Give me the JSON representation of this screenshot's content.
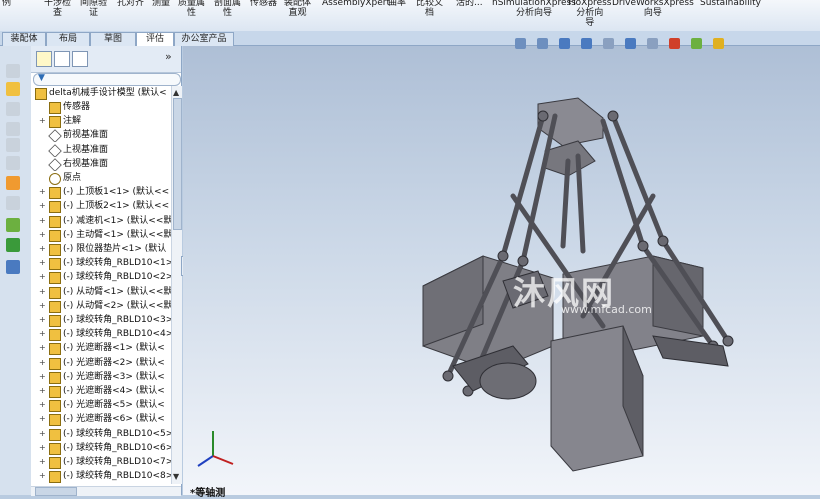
{
  "ribbon": {
    "items": [
      "例",
      "干涉检\n查",
      "间隙验\n证",
      "孔对齐",
      "测量",
      "质量属\n性",
      "剖面属\n性",
      "传感器",
      "装配体\n直观",
      "AssemblyXpert",
      "曲率",
      "比较文\n档",
      "活的...",
      "nSimulationXpress\n分析向导",
      "FloXpress\n分析向\n导",
      "DriveWorksXpress\n向导",
      "Sustainability"
    ]
  },
  "tabs": {
    "items": [
      "装配体",
      "布局",
      "草图",
      "评估",
      "办公室产品"
    ],
    "active": "评估"
  },
  "tree": {
    "root": "delta机械手设计模型 (默认<",
    "items": [
      {
        "label": "传感器",
        "kind": "sensor",
        "exp": ""
      },
      {
        "label": "注解",
        "kind": "note",
        "exp": "+"
      },
      {
        "label": "前视基准面",
        "kind": "plane",
        "exp": ""
      },
      {
        "label": "上视基准面",
        "kind": "plane",
        "exp": ""
      },
      {
        "label": "右视基准面",
        "kind": "plane",
        "exp": ""
      },
      {
        "label": "原点",
        "kind": "origin",
        "exp": ""
      },
      {
        "label": "(-) 上顶板1<1> (默认<<",
        "kind": "part",
        "exp": "+"
      },
      {
        "label": "(-) 上顶板2<1> (默认<<",
        "kind": "part",
        "exp": "+"
      },
      {
        "label": "(-) 减速机<1> (默认<<默",
        "kind": "part",
        "exp": "+"
      },
      {
        "label": "(-) 主动臂<1> (默认<<默",
        "kind": "part",
        "exp": "+"
      },
      {
        "label": "(-) 限位器垫片<1> (默认",
        "kind": "part",
        "exp": "+"
      },
      {
        "label": "(-) 球绞转角_RBLD10<1>",
        "kind": "part",
        "exp": "+"
      },
      {
        "label": "(-) 球绞转角_RBLD10<2>",
        "kind": "part",
        "exp": "+"
      },
      {
        "label": "(-) 从动臂<1> (默认<<默",
        "kind": "part",
        "exp": "+"
      },
      {
        "label": "(-) 从动臂<2> (默认<<默",
        "kind": "part",
        "exp": "+"
      },
      {
        "label": "(-) 球绞转角_RBLD10<3>",
        "kind": "part",
        "exp": "+"
      },
      {
        "label": "(-) 球绞转角_RBLD10<4>",
        "kind": "part",
        "exp": "+"
      },
      {
        "label": "(-) 光遮断器<1> (默认<",
        "kind": "part",
        "exp": "+"
      },
      {
        "label": "(-) 光遮断器<2> (默认<",
        "kind": "part",
        "exp": "+"
      },
      {
        "label": "(-) 光遮断器<3> (默认<",
        "kind": "part",
        "exp": "+"
      },
      {
        "label": "(-) 光遮断器<4> (默认<",
        "kind": "part",
        "exp": "+"
      },
      {
        "label": "(-) 光遮断器<5> (默认<",
        "kind": "part",
        "exp": "+"
      },
      {
        "label": "(-) 光遮断器<6> (默认<",
        "kind": "part",
        "exp": "+"
      },
      {
        "label": "(-) 球绞转角_RBLD10<5>",
        "kind": "part",
        "exp": "+"
      },
      {
        "label": "(-) 球绞转角_RBLD10<6>",
        "kind": "part",
        "exp": "+"
      },
      {
        "label": "(-) 球绞转角_RBLD10<7>",
        "kind": "part",
        "exp": "+"
      },
      {
        "label": "(-) 球绞转角_RBLD10<8>",
        "kind": "part",
        "exp": "+"
      }
    ]
  },
  "viewport": {
    "view_name": "*等轴测",
    "watermark": "沐风网",
    "watermark_url": "www.mfcad.com"
  },
  "colors": {
    "model": "#7f7f86",
    "model_dark": "#4a4a52",
    "background_top": "#aebfd6",
    "background_bottom": "#f2f5fa",
    "accent": "#2e6db5"
  }
}
